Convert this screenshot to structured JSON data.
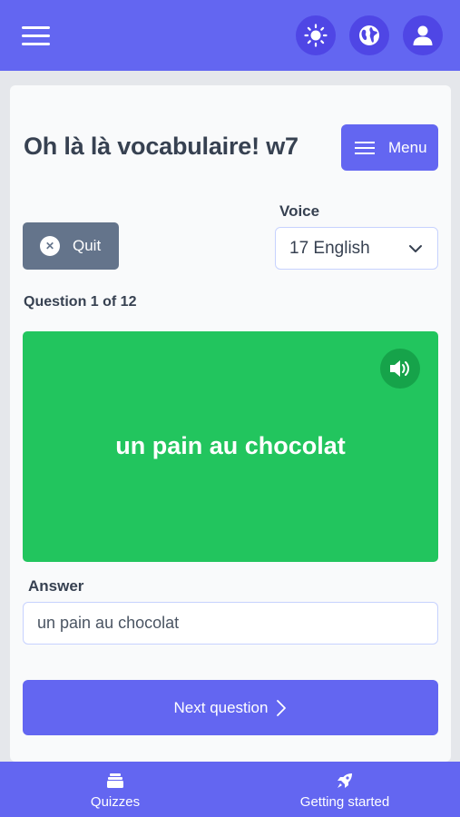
{
  "header": {
    "menu_icon": "hamburger-icon",
    "icons": [
      "sun-icon",
      "globe-icon",
      "user-icon"
    ]
  },
  "quiz": {
    "title": "Oh là là vocabulaire! w7",
    "menu_label": "Menu",
    "quit_label": "Quit",
    "voice_label": "Voice",
    "voice_value": "17 English",
    "question_counter": "Question 1 of 12",
    "phrase": "un pain au chocolat",
    "answer_label": "Answer",
    "answer_value": "un pain au chocolat",
    "next_label": "Next question"
  },
  "bottom_nav": {
    "items": [
      {
        "label": "Quizzes",
        "icon": "stack-icon"
      },
      {
        "label": "Getting started",
        "icon": "rocket-icon"
      }
    ]
  },
  "colors": {
    "primary": "#6366f1",
    "success": "#22c55e",
    "muted": "#64748b"
  }
}
